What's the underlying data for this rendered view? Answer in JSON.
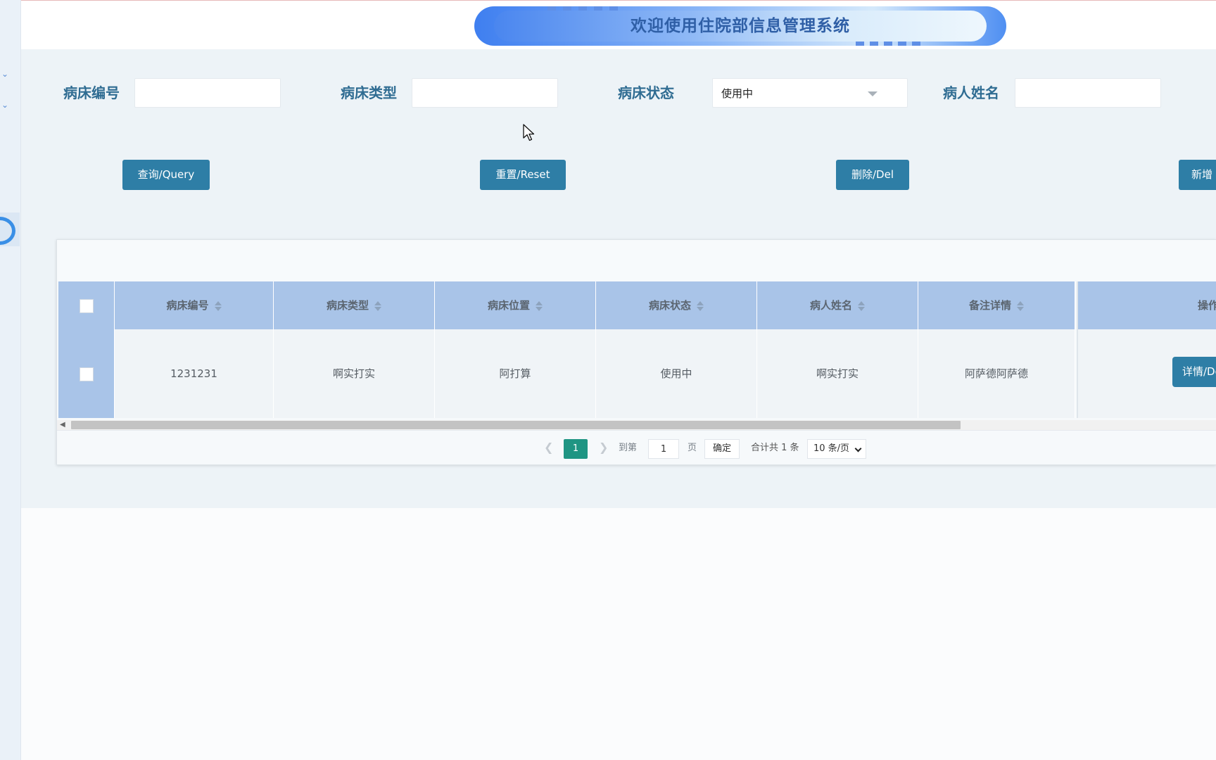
{
  "header": {
    "title": "欢迎使用住院部信息管理系统"
  },
  "search": {
    "bed_no_label": "病床编号",
    "bed_type_label": "病床类型",
    "bed_status_label": "病床状态",
    "bed_status_value": "使用中",
    "patient_name_label": "病人姓名",
    "bed_no_value": "",
    "bed_type_value": "",
    "patient_name_value": ""
  },
  "actions": {
    "query": "查询/Query",
    "reset": "重置/Reset",
    "delete": "删除/Del",
    "add": "新增"
  },
  "table": {
    "columns": [
      "病床编号",
      "病床类型",
      "病床位置",
      "病床状态",
      "病人姓名",
      "备注详情",
      "操作"
    ],
    "rows": [
      {
        "bed_no": "1231231",
        "bed_type": "啊实打实",
        "bed_location": "阿打算",
        "bed_status": "使用中",
        "patient_name": "啊实打实",
        "remarks": "阿萨德阿萨德",
        "action_label": "详情/De"
      }
    ]
  },
  "pagination": {
    "current_page": "1",
    "goto_prefix": "到第",
    "goto_value": "1",
    "goto_suffix": "页",
    "confirm": "确定",
    "total": "合计共 1 条",
    "page_size": "10 条/页"
  },
  "colors": {
    "primary_button": "#2e7ea6",
    "header_row": "#a9c4e8",
    "active_page": "#1f9583",
    "label_text": "#2f6c92"
  }
}
